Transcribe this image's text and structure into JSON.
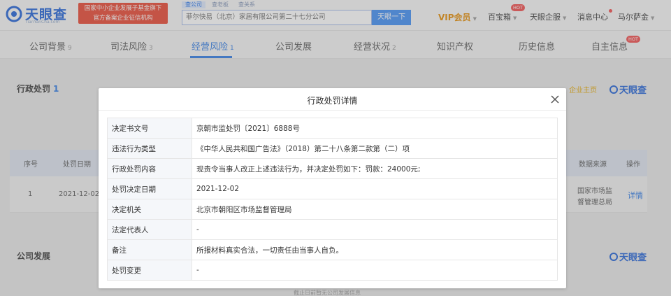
{
  "header": {
    "logo_text": "天眼查",
    "logo_sub": "TianYanCha.com",
    "promo_line1": "国家中小企业发展子基金旗下",
    "promo_line2": "官方备案企业征信机构",
    "search_tabs": [
      "查公司",
      "查老板",
      "查关系"
    ],
    "search_value": "菲尔快易（北京）家居有限公司第二十七分公司",
    "search_button": "天眼一下",
    "vip_label": "VIP会员",
    "baibaoxiang": "百宝箱",
    "tianyan_enterprise": "天眼企服",
    "message_center": "消息中心",
    "user_name": "马尔萨金",
    "hot_badge": "HOT"
  },
  "section_nav": {
    "items": [
      {
        "label": "公司背景",
        "count": "9"
      },
      {
        "label": "司法风险",
        "count": "3"
      },
      {
        "label": "经营风险",
        "count": "1"
      },
      {
        "label": "公司发展",
        "count": ""
      },
      {
        "label": "经营状况",
        "count": "2"
      },
      {
        "label": "知识产权",
        "count": ""
      },
      {
        "label": "历史信息",
        "count": ""
      },
      {
        "label": "自主信息",
        "count": ""
      }
    ],
    "active_index": 2
  },
  "background": {
    "section_title": "行政处罚",
    "section_count": "1",
    "fav_label": "企业主页",
    "watermark": "天眼查",
    "table_headers": [
      "序号",
      "处罚日期",
      "数据来源",
      "操作"
    ],
    "row": {
      "index": "1",
      "date": "2021-12-02",
      "source_line1": "国家市场监",
      "source_line2": "督管理总局",
      "action": "详情"
    },
    "second_section_title": "公司发展",
    "bottom_text": "截止日前暂无公司发展信息"
  },
  "modal": {
    "title": "行政处罚详情",
    "rows": [
      {
        "label": "决定书文号",
        "value": "京朝市监处罚〔2021〕6888号"
      },
      {
        "label": "违法行为类型",
        "value": "《中华人民共和国广告法》（2018）第二十八条第二款第（二）项"
      },
      {
        "label": "行政处罚内容",
        "value": "现责令当事人改正上述违法行为，并决定处罚如下：罚款：24000元;"
      },
      {
        "label": "处罚决定日期",
        "value": "2021-12-02"
      },
      {
        "label": "决定机关",
        "value": "北京市朝阳区市场监督管理局"
      },
      {
        "label": "法定代表人",
        "value": "-"
      },
      {
        "label": "备注",
        "value": "所报材料真实合法，一切责任由当事人自负。"
      },
      {
        "label": "处罚变更",
        "value": "-"
      }
    ]
  },
  "colors": {
    "brand_blue": "#1c5fd6",
    "accent_blue": "#2b78e4",
    "promo_red": "#e8432e",
    "vip_orange": "#e38a00"
  }
}
